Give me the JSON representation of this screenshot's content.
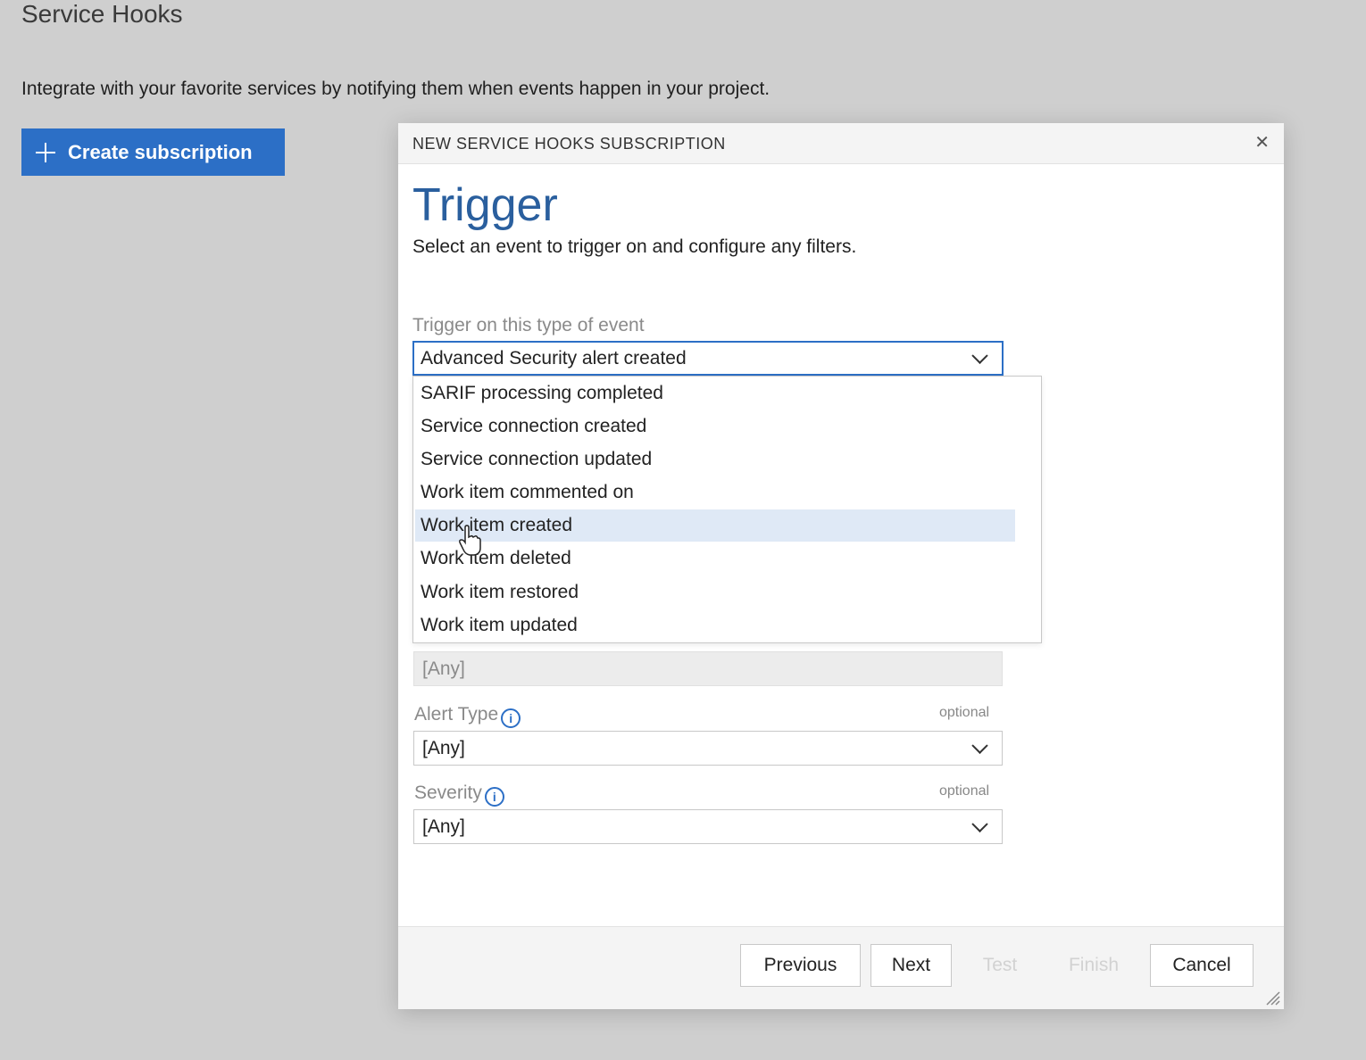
{
  "page": {
    "title": "Service Hooks",
    "description": "Integrate with your favorite services by notifying them when events happen in your project.",
    "create_button": "Create subscription"
  },
  "dialog": {
    "title": "NEW SERVICE HOOKS SUBSCRIPTION",
    "step_title": "Trigger",
    "step_description": "Select an event to trigger on and configure any filters.",
    "event_type": {
      "label": "Trigger on this type of event",
      "value": "Advanced Security alert created",
      "options": [
        "SARIF processing completed",
        "Service connection created",
        "Service connection updated",
        "Work item commented on",
        "Work item created",
        "Work item deleted",
        "Work item restored",
        "Work item updated"
      ],
      "hovered_option": "Work item created"
    },
    "hidden_filter": {
      "value": "[Any]"
    },
    "alert_type": {
      "label": "Alert Type",
      "optional": "optional",
      "value": "[Any]"
    },
    "severity": {
      "label": "Severity",
      "optional": "optional",
      "value": "[Any]"
    },
    "buttons": {
      "previous": "Previous",
      "next": "Next",
      "test": "Test",
      "finish": "Finish",
      "cancel": "Cancel"
    }
  },
  "colors": {
    "accent": "#2c6fc6",
    "title_blue": "#2a5f9e",
    "background": "#cfcfcf",
    "hover": "#dfe9f6"
  }
}
